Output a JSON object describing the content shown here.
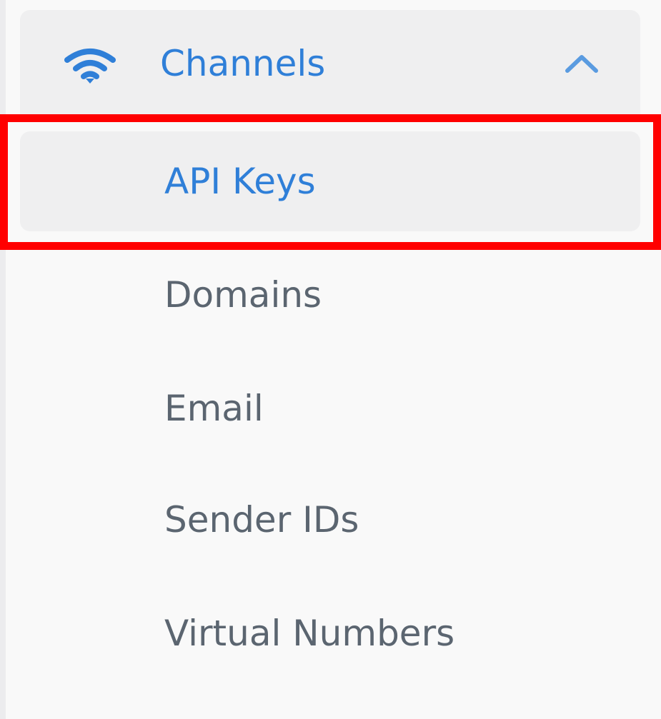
{
  "nav": {
    "header": {
      "label": "Channels",
      "icon": "wifi-icon",
      "toggle_icon": "chevron-up-icon",
      "expanded": true,
      "accent_color": "#2f7fd8"
    },
    "items": [
      {
        "label": "API Keys",
        "active": true
      },
      {
        "label": "Domains",
        "active": false
      },
      {
        "label": "Email",
        "active": false
      },
      {
        "label": "Sender IDs",
        "active": false
      },
      {
        "label": "Virtual Numbers",
        "active": false
      }
    ],
    "highlight": {
      "color": "#ff0000",
      "target": "API Keys"
    }
  }
}
